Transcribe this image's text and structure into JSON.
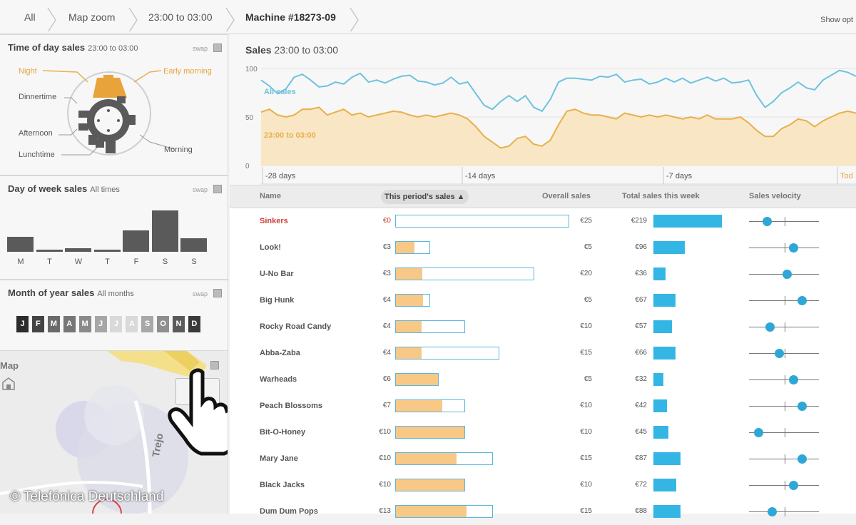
{
  "breadcrumb": [
    "All",
    "Map zoom",
    "23:00 to 03:00",
    "Machine #18273-09"
  ],
  "show_options": "Show opt",
  "panels": {
    "time_of_day": {
      "title": "Time of day sales",
      "subtitle": "23:00 to 03:00",
      "swap": "swap",
      "labels": {
        "night": "Night",
        "early_morning": "Early morning",
        "dinnertime": "Dinnertime",
        "afternoon": "Afternoon",
        "lunchtime": "Lunchtime",
        "morning": "Morning"
      }
    },
    "day_of_week": {
      "title": "Day of week sales",
      "subtitle": "All times",
      "swap": "swap",
      "days": [
        "M",
        "T",
        "W",
        "T",
        "F",
        "S",
        "S"
      ],
      "values": [
        0.37,
        0.05,
        0.09,
        0.05,
        0.52,
        1.0,
        0.33
      ]
    },
    "month_of_year": {
      "title": "Month of year sales",
      "subtitle": "All months",
      "swap": "swap",
      "months": [
        "J",
        "F",
        "M",
        "A",
        "M",
        "J",
        "J",
        "A",
        "S",
        "O",
        "N",
        "D"
      ],
      "shades": [
        "#2c2c2c",
        "#444444",
        "#6a6a6a",
        "#767676",
        "#8a8a8a",
        "#a6a6a6",
        "#d9d9d9",
        "#d9d9d9",
        "#a8a8a8",
        "#8e8e8e",
        "#5a5a5a",
        "#3a3a3a"
      ]
    },
    "map": {
      "title": "Map",
      "street": "Trejo"
    }
  },
  "copyright": "© Telefónica Deutschland",
  "chart": {
    "title_bold": "Sales",
    "title_rest": "23:00 to 03:00",
    "y_ticks": [
      "100",
      "50",
      "0"
    ],
    "x_ticks": [
      "-28 days",
      "-14 days",
      "-7 days",
      "Tod"
    ],
    "series": [
      {
        "name": "All sales",
        "color": "#6fc2de"
      },
      {
        "name": "23:00 to 03:00",
        "color": "#e8b04c"
      }
    ]
  },
  "chart_data": {
    "type": "area",
    "title": "Sales 23:00 to 03:00",
    "ylim": [
      0,
      100
    ],
    "x_ticks": [
      "-28 days",
      "-14 days",
      "-7 days",
      "Tod"
    ],
    "series": [
      {
        "name": "All sales",
        "values": [
          88,
          82,
          74,
          79,
          91,
          94,
          88,
          81,
          82,
          86,
          84,
          91,
          95,
          86,
          88,
          85,
          89,
          92,
          93,
          87,
          86,
          83,
          85,
          91,
          84,
          86,
          74,
          62,
          58,
          66,
          72,
          66,
          72,
          60,
          56,
          68,
          86,
          90,
          90,
          89,
          88,
          92,
          91,
          94,
          86,
          88,
          89,
          84,
          86,
          90,
          86,
          90,
          85,
          88,
          91,
          87,
          90,
          85,
          86,
          88,
          72,
          60,
          66,
          75,
          80,
          86,
          80,
          78,
          88,
          93,
          98,
          96,
          92
        ]
      },
      {
        "name": "23:00 to 03:00",
        "values": [
          55,
          58,
          52,
          50,
          52,
          58,
          58,
          60,
          52,
          55,
          58,
          52,
          54,
          50,
          52,
          54,
          56,
          55,
          52,
          50,
          52,
          50,
          52,
          54,
          52,
          48,
          40,
          30,
          24,
          18,
          20,
          28,
          30,
          22,
          20,
          26,
          42,
          56,
          58,
          54,
          52,
          52,
          50,
          48,
          54,
          52,
          50,
          52,
          50,
          52,
          50,
          48,
          50,
          48,
          52,
          48,
          48,
          48,
          50,
          44,
          36,
          30,
          30,
          38,
          42,
          48,
          46,
          40,
          46,
          50,
          54,
          56,
          54
        ]
      }
    ]
  },
  "table": {
    "headers": {
      "name": "Name",
      "period": "This period's sales",
      "overall": "Overall sales",
      "week": "Total sales this week",
      "velocity": "Sales velocity"
    },
    "rows": [
      {
        "name": "Sinkers",
        "price": "€0",
        "period_frac": 0,
        "bar_frac": 1.0,
        "overall": "€25",
        "week": "€219",
        "week_frac": 1.0,
        "velocity": 0.26,
        "alert": true
      },
      {
        "name": "Look!",
        "price": "€3",
        "period_frac": 0.55,
        "bar_frac": 0.2,
        "overall": "€5",
        "week": "€96",
        "week_frac": 0.46,
        "velocity": 0.63,
        "alert": false
      },
      {
        "name": "U-No Bar",
        "price": "€3",
        "period_frac": 0.19,
        "bar_frac": 0.8,
        "overall": "€20",
        "week": "€36",
        "week_frac": 0.18,
        "velocity": 0.54,
        "alert": false
      },
      {
        "name": "Big Hunk",
        "price": "€4",
        "period_frac": 0.8,
        "bar_frac": 0.2,
        "overall": "€5",
        "week": "€67",
        "week_frac": 0.32,
        "velocity": 0.76,
        "alert": false
      },
      {
        "name": "Rocky Road Candy",
        "price": "€4",
        "period_frac": 0.37,
        "bar_frac": 0.4,
        "overall": "€10",
        "week": "€57",
        "week_frac": 0.27,
        "velocity": 0.3,
        "alert": false
      },
      {
        "name": "Abba-Zaba",
        "price": "€4",
        "period_frac": 0.25,
        "bar_frac": 0.6,
        "overall": "€15",
        "week": "€66",
        "week_frac": 0.32,
        "velocity": 0.43,
        "alert": false
      },
      {
        "name": "Warheads",
        "price": "€6",
        "period_frac": 1.0,
        "bar_frac": 0.25,
        "overall": "€5",
        "week": "€32",
        "week_frac": 0.15,
        "velocity": 0.63,
        "alert": false
      },
      {
        "name": "Peach Blossoms",
        "price": "€7",
        "period_frac": 0.68,
        "bar_frac": 0.4,
        "overall": "€10",
        "week": "€42",
        "week_frac": 0.2,
        "velocity": 0.76,
        "alert": false
      },
      {
        "name": "Bit-O-Honey",
        "price": "€10",
        "period_frac": 1.0,
        "bar_frac": 0.4,
        "overall": "€10",
        "week": "€45",
        "week_frac": 0.22,
        "velocity": 0.13,
        "alert": false
      },
      {
        "name": "Mary Jane",
        "price": "€10",
        "period_frac": 0.63,
        "bar_frac": 0.56,
        "overall": "€15",
        "week": "€87",
        "week_frac": 0.4,
        "velocity": 0.76,
        "alert": false
      },
      {
        "name": "Black Jacks",
        "price": "€10",
        "period_frac": 1.0,
        "bar_frac": 0.4,
        "overall": "€10",
        "week": "€72",
        "week_frac": 0.33,
        "velocity": 0.63,
        "alert": false
      },
      {
        "name": "Dum Dum Pops",
        "price": "€13",
        "period_frac": 0.73,
        "bar_frac": 0.56,
        "overall": "€15",
        "week": "€88",
        "week_frac": 0.4,
        "velocity": 0.33,
        "alert": false
      }
    ]
  }
}
